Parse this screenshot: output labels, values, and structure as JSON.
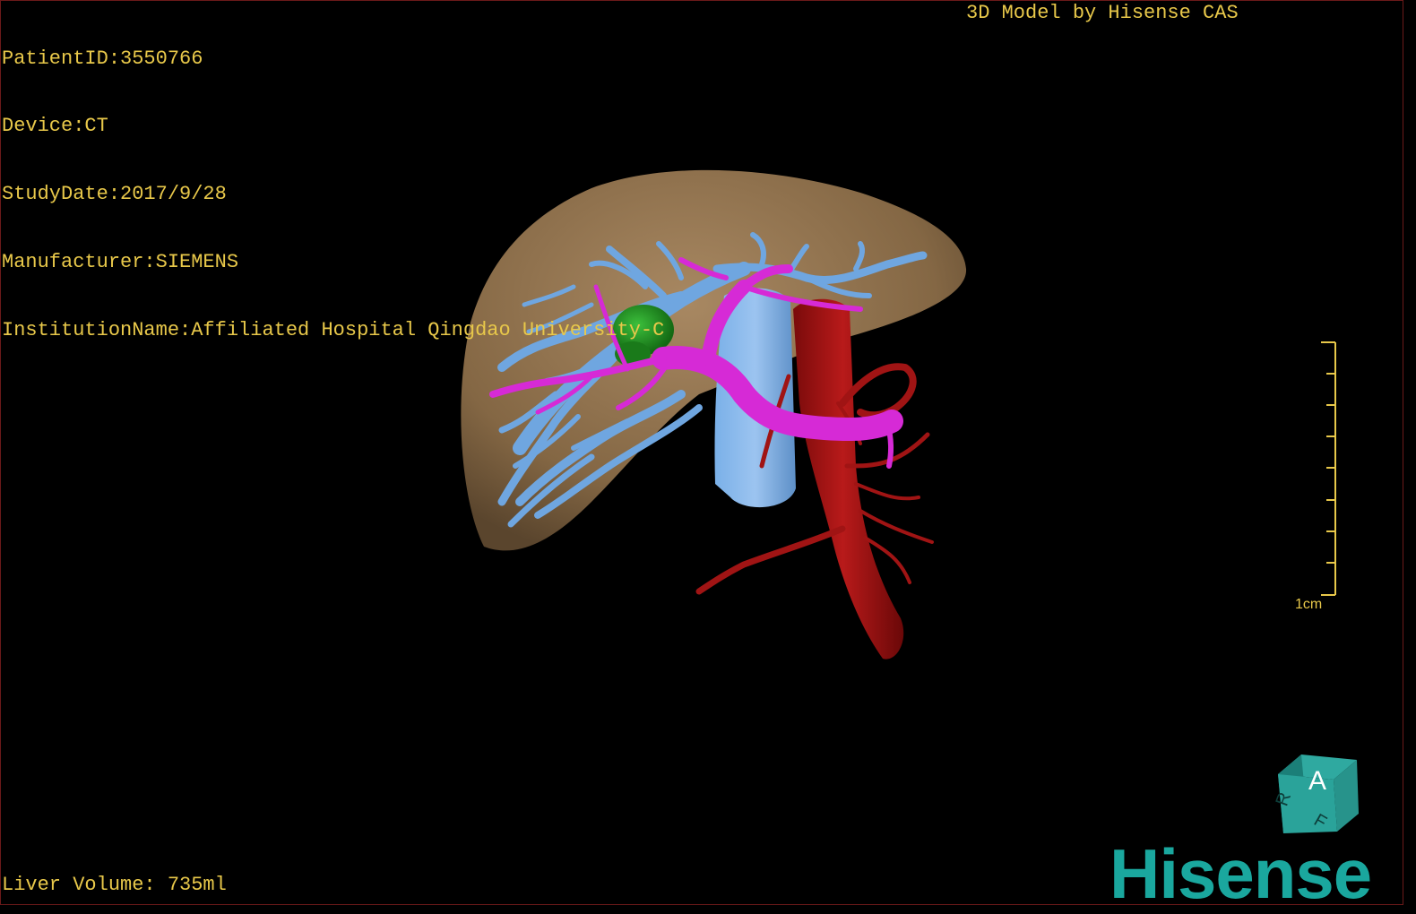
{
  "overlay": {
    "patient_id": "PatientID:3550766",
    "device": "Device:CT",
    "study_date": "StudyDate:2017/9/28",
    "manufacturer": "Manufacturer:SIEMENS",
    "institution": "InstitutionName:Affiliated Hospital Qingdao University-C",
    "model_credit": "3D Model by Hisense CAS",
    "liver_volume": "Liver Volume: 735ml"
  },
  "scale": {
    "label": "1cm"
  },
  "orientation_cube": {
    "front_label": "A",
    "side_label": "R",
    "top_label": "F"
  },
  "brand": {
    "logo_text": "Hisense"
  },
  "colors": {
    "text": "#e8c84a",
    "liver": "#8a6d4b",
    "hepatic_vein": "#6fa6e0",
    "portal_vein": "#d62ad6",
    "artery": "#a01414",
    "lesion": "#1f8a1f",
    "brand": "#1aa79e"
  }
}
